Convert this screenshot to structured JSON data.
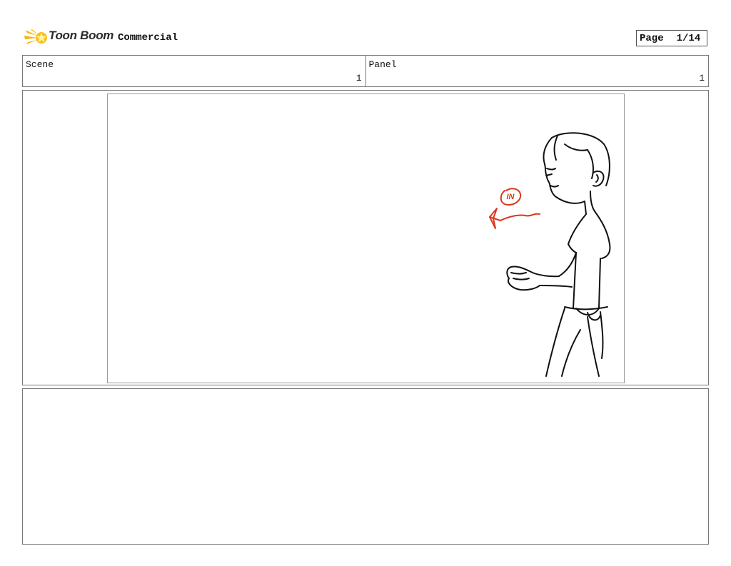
{
  "header": {
    "brand": "Toon Boom",
    "project": "Commercial",
    "page_label": "Page",
    "page_value": "1/14"
  },
  "info": {
    "scene_label": "Scene",
    "scene_value": "1",
    "panel_label": "Panel",
    "panel_value": "1"
  },
  "drawing": {
    "annotation_text": "IN",
    "line_color": "#111111",
    "annotation_color": "#d9381e"
  },
  "notes": {
    "text": ""
  }
}
